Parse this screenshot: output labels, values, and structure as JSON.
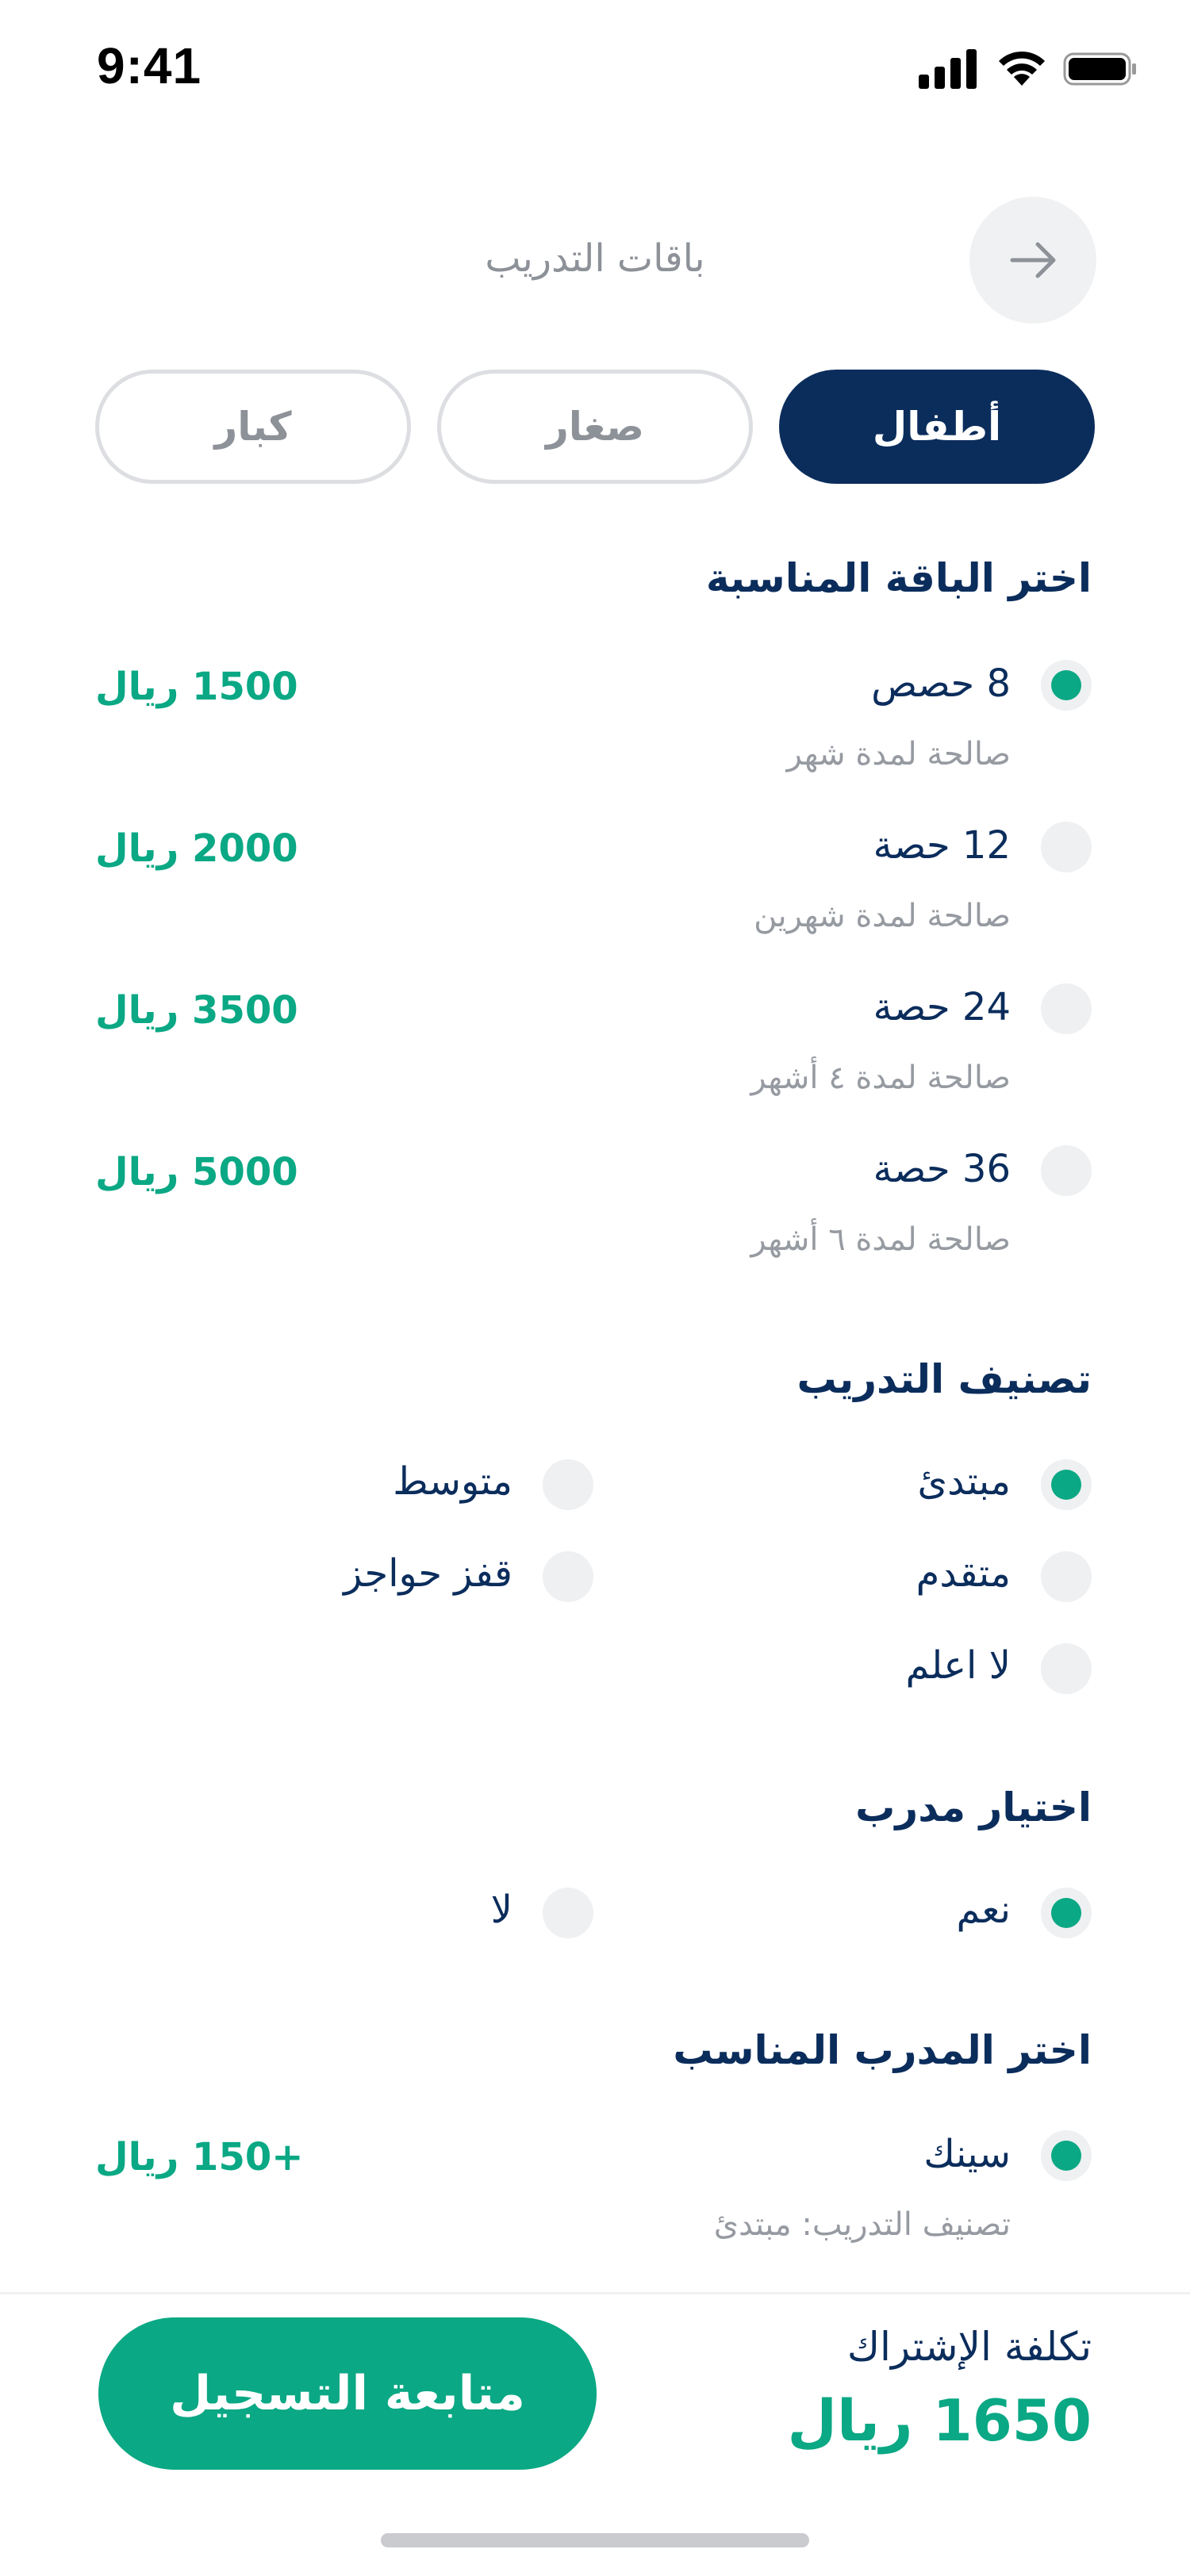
{
  "status_bar": {
    "time": "9:41"
  },
  "header": {
    "title": "باقات التدريب",
    "back_icon": "arrow-right-icon"
  },
  "tabs": [
    {
      "label": "أطفال",
      "active": true
    },
    {
      "label": "صغار",
      "active": false
    },
    {
      "label": "كبار",
      "active": false
    }
  ],
  "packages": {
    "title": "اختر الباقة المناسبة",
    "items": [
      {
        "label": "8 حصص",
        "validity": "صالحة لمدة شهر",
        "price": "1500 ريال",
        "selected": true
      },
      {
        "label": "12 حصة",
        "validity": "صالحة لمدة شهرين",
        "price": "2000 ريال",
        "selected": false
      },
      {
        "label": "24 حصة",
        "validity": "صالحة لمدة ٤ أشهر",
        "price": "3500 ريال",
        "selected": false
      },
      {
        "label": "36 حصة",
        "validity": "صالحة لمدة ٦ أشهر",
        "price": "5000 ريال",
        "selected": false
      }
    ]
  },
  "level": {
    "title": "تصنيف التدريب",
    "options": [
      {
        "label": "مبتدئ",
        "selected": true
      },
      {
        "label": "متوسط",
        "selected": false
      },
      {
        "label": "متقدم",
        "selected": false
      },
      {
        "label": "قفز حواجز",
        "selected": false
      },
      {
        "label": "لا اعلم",
        "selected": false
      }
    ]
  },
  "coach_choice": {
    "title": "اختيار مدرب",
    "options": [
      {
        "label": "نعم",
        "selected": true
      },
      {
        "label": "لا",
        "selected": false
      }
    ]
  },
  "coach": {
    "title": "اختر المدرب المناسب",
    "items": [
      {
        "name": "سينك",
        "level": "تصنيف التدريب: مبتدئ",
        "price": "+150 ريال",
        "selected": true
      }
    ]
  },
  "footer": {
    "cost_label": "تكلفة الإشتراك",
    "cost_value": "1650 ريال",
    "continue_label": "متابعة التسجيل"
  },
  "colors": {
    "primary": "#0b2d5c",
    "accent": "#0aa884",
    "muted": "#8d9198",
    "radio_bg": "#eef0f2"
  }
}
